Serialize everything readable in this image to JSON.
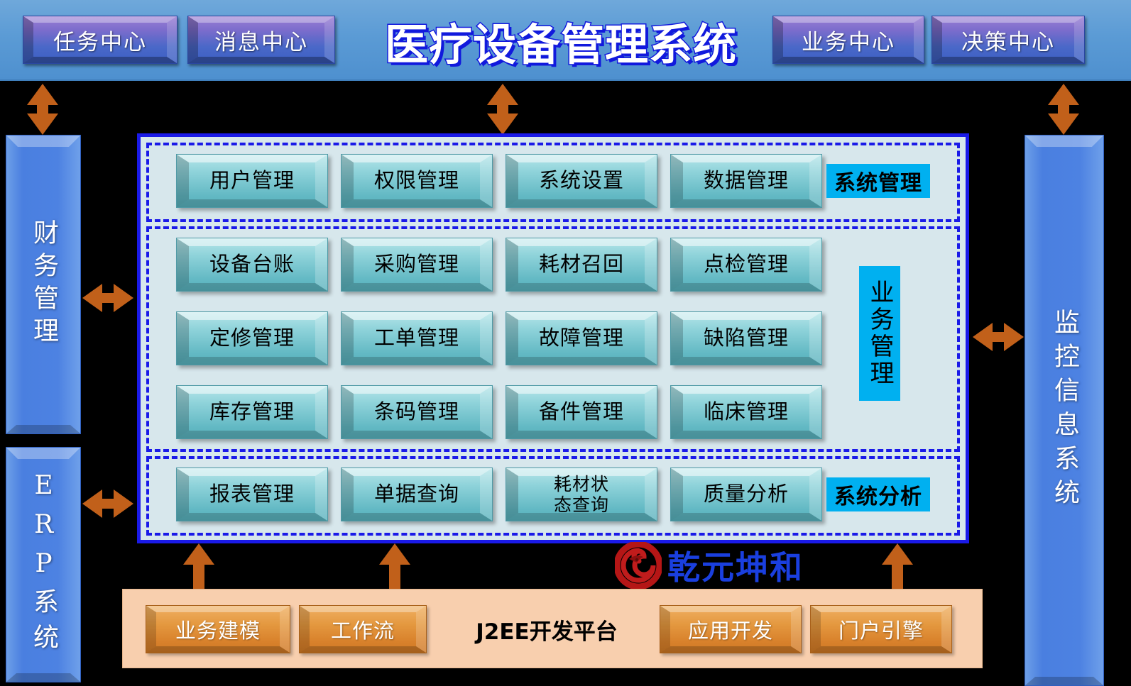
{
  "header": {
    "title": "医疗设备管理系统",
    "buttons": [
      {
        "label": "任务中心"
      },
      {
        "label": "消息中心"
      },
      {
        "label": "业务中心"
      },
      {
        "label": "决策中心"
      }
    ]
  },
  "left_sidebar": {
    "items": [
      {
        "label": "财务管理"
      },
      {
        "label": "ERP系统"
      }
    ]
  },
  "right_sidebar": {
    "items": [
      {
        "label": "监控信息系统"
      }
    ]
  },
  "main": {
    "groups": [
      {
        "tag": "系统管理",
        "rows": [
          [
            "用户管理",
            "权限管理",
            "系统设置",
            "数据管理"
          ]
        ]
      },
      {
        "tag": "业务管理",
        "rows": [
          [
            "设备台账",
            "采购管理",
            "耗材召回",
            "点检管理"
          ],
          [
            "定修管理",
            "工单管理",
            "故障管理",
            "缺陷管理"
          ],
          [
            "库存管理",
            "条码管理",
            "备件管理",
            "临床管理"
          ]
        ]
      },
      {
        "tag": "系统分析",
        "rows": [
          [
            "报表管理",
            "单据查询",
            "耗材状\n态查询",
            "质量分析"
          ]
        ]
      }
    ]
  },
  "platform": {
    "label": "J2EE开发平台",
    "buttons_left": [
      {
        "label": "业务建模"
      },
      {
        "label": "工作流"
      }
    ],
    "buttons_right": [
      {
        "label": "应用开发"
      },
      {
        "label": "门户引擎"
      }
    ]
  },
  "logo": {
    "text": "乾元坤和",
    "mark": "dragon-spiral-icon"
  },
  "colors": {
    "header_bg": "#5b9bd5",
    "title_fill": "#ffffff",
    "title_stroke": "#1119dd",
    "panel_border": "#1a1ae8",
    "panel_bg": "#d7e7ec",
    "module_button": "#8fd3da",
    "tag_bg": "#00b0f0",
    "platform_bg": "#f8cfae",
    "platform_button": "#e4983f",
    "arrow": "#c1601a",
    "sidebar": "#4d82e2",
    "logo_text": "#1a3fdf"
  }
}
